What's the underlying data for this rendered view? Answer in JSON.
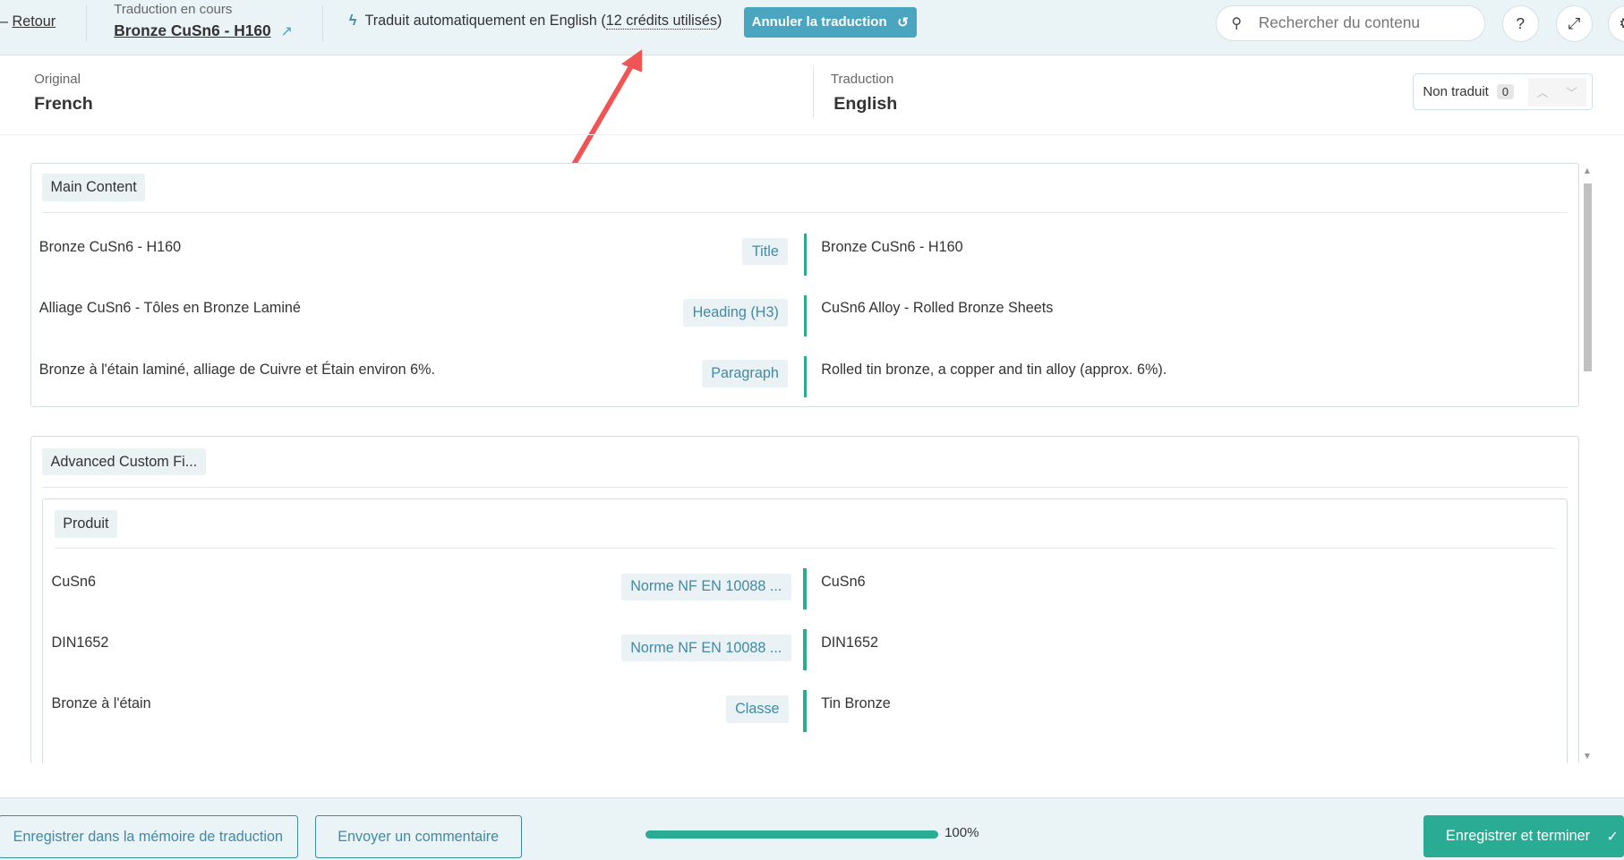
{
  "topbar": {
    "back": "Retour",
    "status_label": "Traduction en cours",
    "doc_title": "Bronze CuSn6 - H160",
    "auto_text": "Traduit automatiquement en English (",
    "credits": "12 crédits utilisés",
    "auto_close": ")",
    "cancel_button": "Annuler la traduction",
    "search_placeholder": "Rechercher du contenu"
  },
  "languages": {
    "original_label": "Original",
    "original": "French",
    "translation_label": "Traduction",
    "translation": "English",
    "untranslated_label": "Non traduit",
    "untranslated_count": "0"
  },
  "sections": [
    {
      "title": "Main Content",
      "rows": [
        {
          "source": "Bronze CuSn6 - H160",
          "tag": "Title",
          "target": "Bronze CuSn6 - H160"
        },
        {
          "source": "Alliage CuSn6 - Tôles en Bronze Laminé",
          "tag": "Heading (H3)",
          "target": "CuSn6 Alloy - Rolled Bronze Sheets"
        },
        {
          "source": "Bronze à l'étain laminé, alliage de Cuivre et Étain environ 6%.",
          "tag": "Paragraph",
          "target": "Rolled tin bronze, a copper and tin alloy (approx. 6%)."
        }
      ]
    },
    {
      "title": "Advanced Custom Fi...",
      "subtitle": "Produit",
      "rows": [
        {
          "source": "CuSn6",
          "tag": "Norme NF EN 10088 ...",
          "target": "CuSn6"
        },
        {
          "source": "DIN1652",
          "tag": "Norme NF EN 10088 ...",
          "target": "DIN1652"
        },
        {
          "source": "Bronze à l'étain",
          "tag": "Classe",
          "target": "Tin Bronze"
        }
      ]
    }
  ],
  "footer": {
    "save_memory": "Enregistrer dans la mémoire de traduction",
    "send_comment": "Envoyer un commentaire",
    "progress_percent": 100,
    "progress_label": "100%",
    "save_finish": "Enregistrer et terminer"
  },
  "colors": {
    "accent": "#2aab94",
    "blue": "#4aa5c0",
    "annotation": "#f05454"
  }
}
